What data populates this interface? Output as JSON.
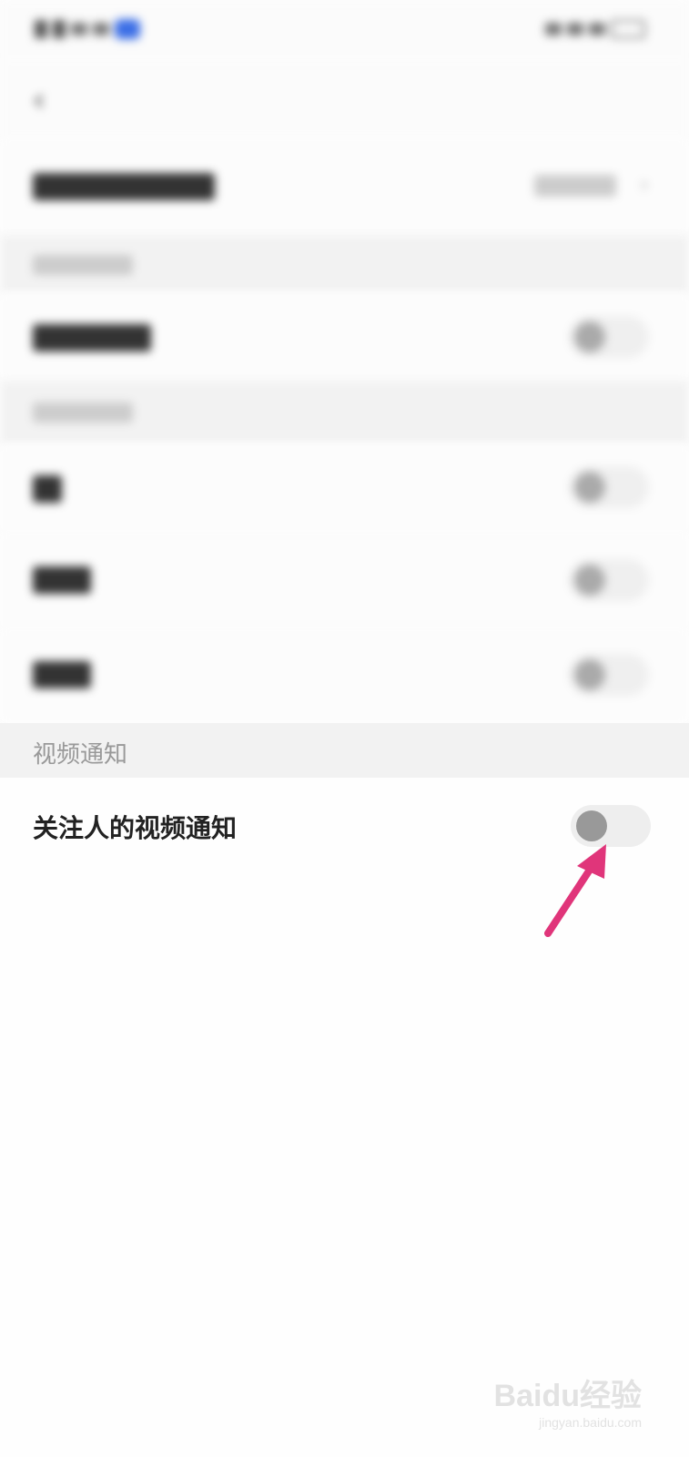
{
  "status_bar": {
    "left_text": "",
    "right_text": ""
  },
  "header": {
    "back_icon": "chevron-left-icon",
    "title": ""
  },
  "top_row": {
    "label": "",
    "value": ""
  },
  "sections": [
    {
      "label": ""
    },
    {
      "label": ""
    },
    {
      "label": "视频通知"
    }
  ],
  "rows": [
    {
      "label": "",
      "enabled": false
    },
    {
      "label": "",
      "enabled": false
    },
    {
      "label": "",
      "enabled": false
    },
    {
      "label": "",
      "enabled": false
    },
    {
      "label": "关注人的视频通知",
      "enabled": false
    }
  ],
  "annotation": {
    "color": "#e0357a"
  },
  "watermark": {
    "main": "Baidu经验",
    "sub": "jingyan.baidu.com"
  }
}
